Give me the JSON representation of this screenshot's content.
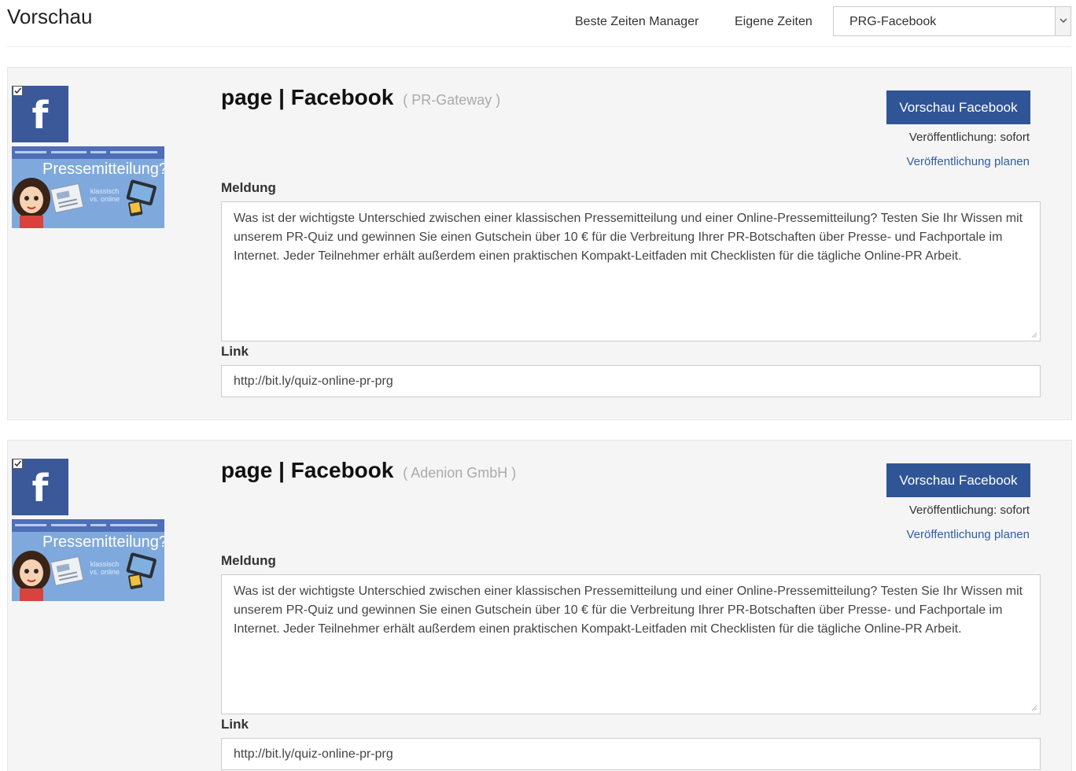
{
  "header": {
    "title": "Vorschau",
    "links": [
      "Beste Zeiten Manager",
      "Eigene Zeiten"
    ],
    "account_select": {
      "selected": "PRG-Facebook"
    }
  },
  "posts": [
    {
      "checked": true,
      "icon": "facebook-icon",
      "thumbnail_title": "Pressemitteilung?",
      "thumbnail_subtitle": "klassisch vs. online",
      "title": "page | Facebook",
      "account": "( PR-Gateway )",
      "preview_button": "Vorschau Facebook",
      "publish_status": "Veröffentlichung: sofort",
      "schedule_link": "Veröffentlichung planen",
      "message_label": "Meldung",
      "message": "Was ist der wichtigste Unterschied zwischen einer klassischen Pressemitteilung und einer Online-Pressemitteilung? Testen Sie Ihr Wissen mit unserem PR-Quiz und gewinnen Sie einen Gutschein über 10 € für die Verbreitung Ihrer PR-Botschaften über Presse- und Fachportale im Internet. Jeder Teilnehmer erhält außerdem einen praktischen Kompakt-Leitfaden mit Checklisten für die tägliche Online-PR Arbeit.",
      "link_label": "Link",
      "link": "http://bit.ly/quiz-online-pr-prg"
    },
    {
      "checked": true,
      "icon": "facebook-icon",
      "thumbnail_title": "Pressemitteilung?",
      "thumbnail_subtitle": "klassisch vs. online",
      "title": "page | Facebook",
      "account": "( Adenion GmbH )",
      "preview_button": "Vorschau Facebook",
      "publish_status": "Veröffentlichung: sofort",
      "schedule_link": "Veröffentlichung planen",
      "message_label": "Meldung",
      "message": "Was ist der wichtigste Unterschied zwischen einer klassischen Pressemitteilung und einer Online-Pressemitteilung? Testen Sie Ihr Wissen mit unserem PR-Quiz und gewinnen Sie einen Gutschein über 10 € für die Verbreitung Ihrer PR-Botschaften über Presse- und Fachportale im Internet. Jeder Teilnehmer erhält außerdem einen praktischen Kompakt-Leitfaden mit Checklisten für die tägliche Online-PR Arbeit.",
      "link_label": "Link",
      "link": "http://bit.ly/quiz-online-pr-prg"
    }
  ],
  "colors": {
    "facebook_blue": "#3b5998",
    "button_blue": "#2f5597",
    "link_blue": "#2f5fa3",
    "card_background": "#f5f5f5"
  }
}
